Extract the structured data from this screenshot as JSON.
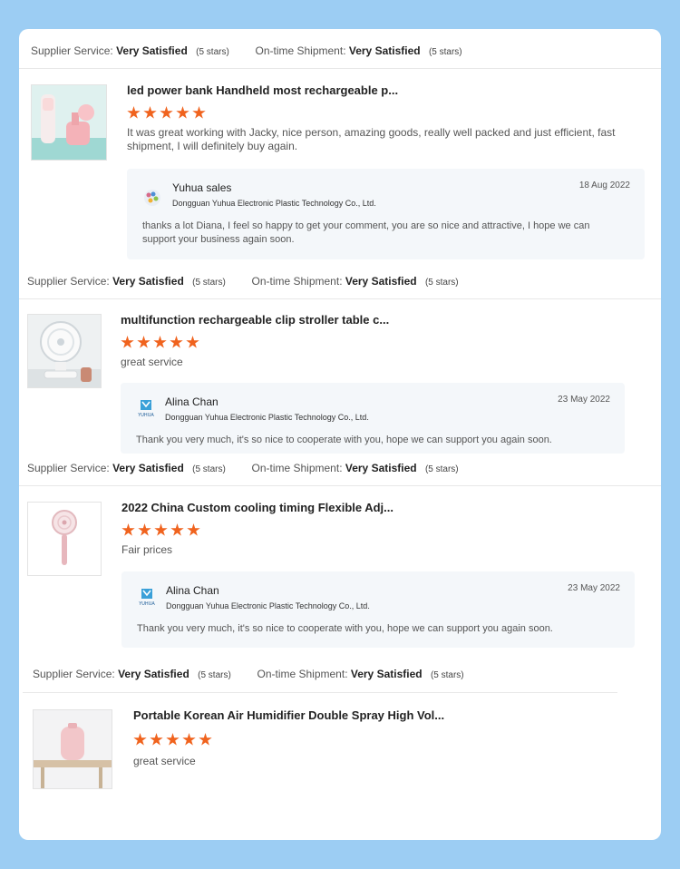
{
  "labels": {
    "supplier_service": "Supplier Service:",
    "ontime_shipment": "On-time Shipment:"
  },
  "top_rating": {
    "supplier_value": "Very Satisfied",
    "supplier_stars": "(5 stars)",
    "shipment_value": "Very Satisfied",
    "shipment_stars": "(5 stars)"
  },
  "reviews": [
    {
      "title": "led power bank Handheld most rechargeable p...",
      "stars": 5,
      "comment": "It was great working with Jacky,  nice person, amazing goods, really well packed and just efficient, fast shipment,  I will definitely buy again.",
      "reply": {
        "name": "Yuhua sales",
        "company": "Dongguan Yuhua Electronic Plastic Technology Co., Ltd.",
        "date": "18 Aug 2022",
        "text": "thanks a lot Diana,  I feel so happy to get your comment,  you are so nice and attractive, I hope we can support your business again soon."
      },
      "rating": {
        "supplier_value": "Very Satisfied",
        "supplier_stars": "(5 stars)",
        "shipment_value": "Very Satisfied",
        "shipment_stars": "(5 stars)"
      }
    },
    {
      "title": "multifunction rechargeable clip stroller table c...",
      "stars": 5,
      "comment": "great service",
      "reply": {
        "name": "Alina Chan",
        "company": "Dongguan Yuhua Electronic Plastic Technology Co., Ltd.",
        "date": "23 May 2022",
        "text": "Thank you very much, it's so nice to cooperate with you, hope we can support you again soon."
      },
      "rating": {
        "supplier_value": "Very Satisfied",
        "supplier_stars": "(5 stars)",
        "shipment_value": "Very Satisfied",
        "shipment_stars": "(5 stars)"
      }
    },
    {
      "title": "2022 China Custom cooling timing Flexible Adj...",
      "stars": 5,
      "comment": "Fair prices",
      "reply": {
        "name": "Alina Chan",
        "company": "Dongguan Yuhua Electronic Plastic Technology Co., Ltd.",
        "date": "23 May 2022",
        "text": "Thank you very much, it's so nice to cooperate with you, hope we can support you again soon."
      },
      "rating": {
        "supplier_value": "Very Satisfied",
        "supplier_stars": "(5 stars)",
        "shipment_value": "Very Satisfied",
        "shipment_stars": "(5 stars)"
      }
    },
    {
      "title": "Portable Korean Air Humidifier Double Spray High Vol...",
      "stars": 5,
      "comment": "great service"
    }
  ],
  "colors": {
    "background": "#9ccdf3",
    "star": "#f0631e",
    "reply_bg": "#f4f7fa"
  },
  "icons": {
    "logo_1": "yuhua-logo-icon",
    "logo_2": "yuhua-logo-icon"
  }
}
